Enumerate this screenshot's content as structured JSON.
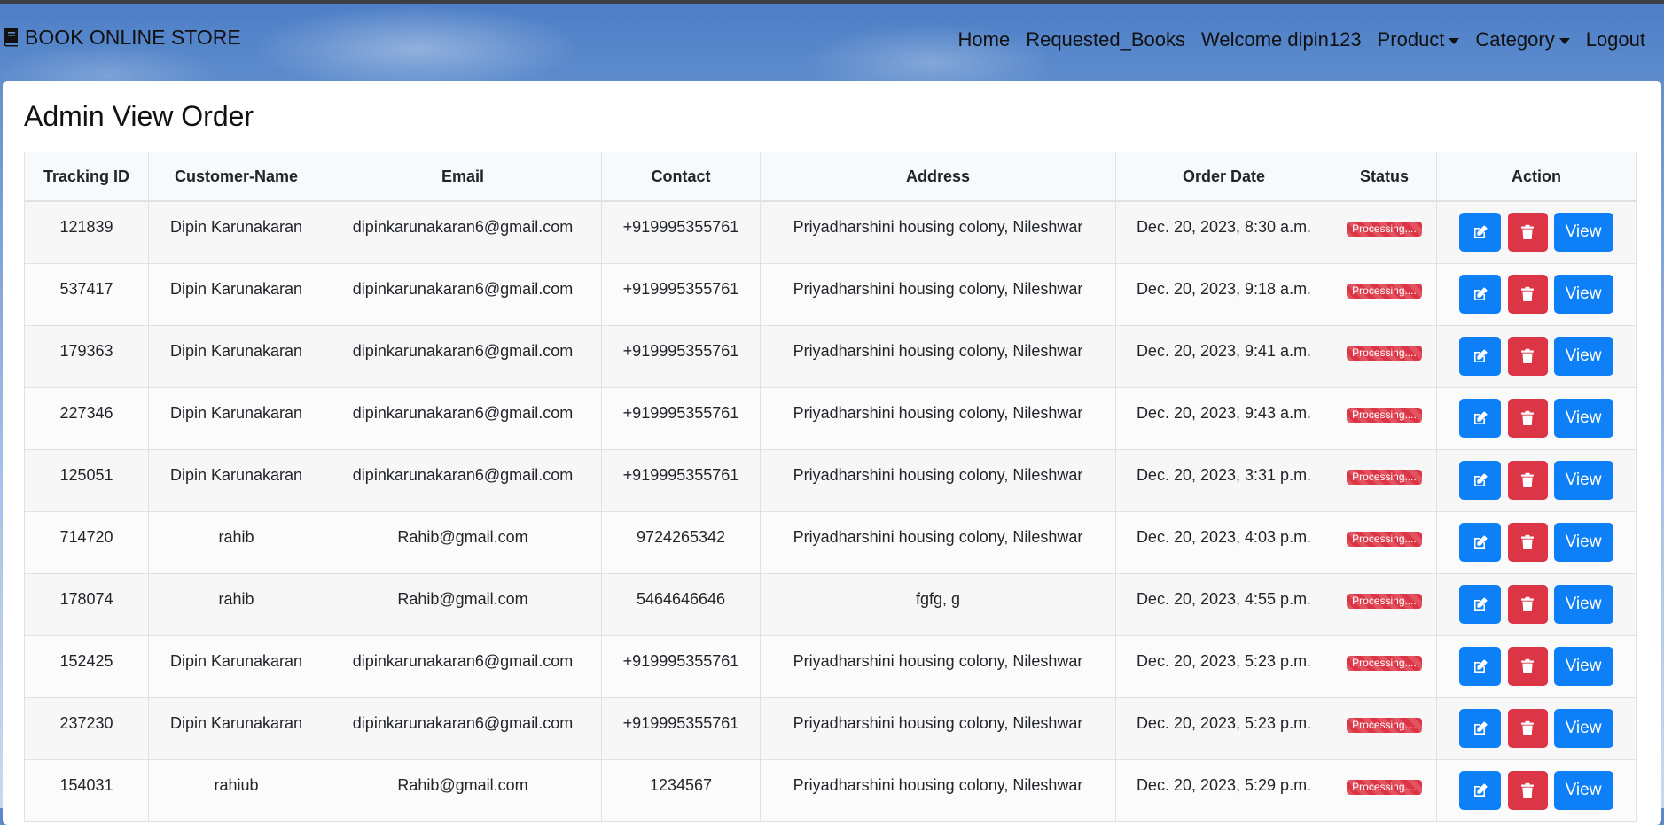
{
  "navbar": {
    "brand": "BOOK ONLINE STORE",
    "links": {
      "home": "Home",
      "requested": "Requested_Books",
      "welcome": "Welcome dipin123",
      "product": "Product",
      "category": "Category",
      "logout": "Logout"
    }
  },
  "page": {
    "title": "Admin View Order"
  },
  "table": {
    "headers": [
      "Tracking ID",
      "Customer-Name",
      "Email",
      "Contact",
      "Address",
      "Order Date",
      "Status",
      "Action"
    ],
    "view_label": "View",
    "rows": [
      {
        "id": "121839",
        "name": "Dipin Karunakaran",
        "email": "dipinkarunakaran6@gmail.com",
        "contact": "+919995355761",
        "address": "Priyadharshini housing colony, Nileshwar",
        "date": "Dec. 20, 2023, 8:30 a.m.",
        "status": "Processing...."
      },
      {
        "id": "537417",
        "name": "Dipin Karunakaran",
        "email": "dipinkarunakaran6@gmail.com",
        "contact": "+919995355761",
        "address": "Priyadharshini housing colony, Nileshwar",
        "date": "Dec. 20, 2023, 9:18 a.m.",
        "status": "Processing...."
      },
      {
        "id": "179363",
        "name": "Dipin Karunakaran",
        "email": "dipinkarunakaran6@gmail.com",
        "contact": "+919995355761",
        "address": "Priyadharshini housing colony, Nileshwar",
        "date": "Dec. 20, 2023, 9:41 a.m.",
        "status": "Processing...."
      },
      {
        "id": "227346",
        "name": "Dipin Karunakaran",
        "email": "dipinkarunakaran6@gmail.com",
        "contact": "+919995355761",
        "address": "Priyadharshini housing colony, Nileshwar",
        "date": "Dec. 20, 2023, 9:43 a.m.",
        "status": "Processing...."
      },
      {
        "id": "125051",
        "name": "Dipin Karunakaran",
        "email": "dipinkarunakaran6@gmail.com",
        "contact": "+919995355761",
        "address": "Priyadharshini housing colony, Nileshwar",
        "date": "Dec. 20, 2023, 3:31 p.m.",
        "status": "Processing...."
      },
      {
        "id": "714720",
        "name": "rahib",
        "email": "Rahib@gmail.com",
        "contact": "9724265342",
        "address": "Priyadharshini housing colony, Nileshwar",
        "date": "Dec. 20, 2023, 4:03 p.m.",
        "status": "Processing...."
      },
      {
        "id": "178074",
        "name": "rahib",
        "email": "Rahib@gmail.com",
        "contact": "5464646646",
        "address": "fgfg, g",
        "date": "Dec. 20, 2023, 4:55 p.m.",
        "status": "Processing...."
      },
      {
        "id": "152425",
        "name": "Dipin Karunakaran",
        "email": "dipinkarunakaran6@gmail.com",
        "contact": "+919995355761",
        "address": "Priyadharshini housing colony, Nileshwar",
        "date": "Dec. 20, 2023, 5:23 p.m.",
        "status": "Processing...."
      },
      {
        "id": "237230",
        "name": "Dipin Karunakaran",
        "email": "dipinkarunakaran6@gmail.com",
        "contact": "+919995355761",
        "address": "Priyadharshini housing colony, Nileshwar",
        "date": "Dec. 20, 2023, 5:23 p.m.",
        "status": "Processing...."
      },
      {
        "id": "154031",
        "name": "rahiub",
        "email": "Rahib@gmail.com",
        "contact": "1234567",
        "address": "Priyadharshini housing colony, Nileshwar",
        "date": "Dec. 20, 2023, 5:29 p.m.",
        "status": "Processing...."
      }
    ]
  },
  "colors": {
    "primary": "#0d7ff7",
    "danger": "#dc3545",
    "navbar": "#5d8ccd"
  },
  "icons": {
    "brand": "book-icon",
    "edit": "edit-icon",
    "delete": "trash-icon"
  }
}
